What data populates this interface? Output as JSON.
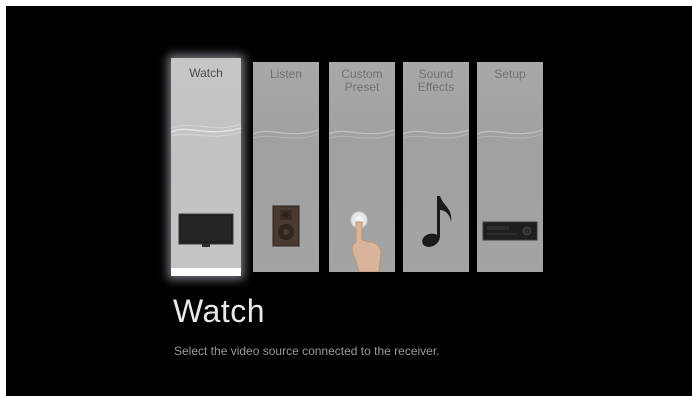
{
  "menu": {
    "items": [
      {
        "label": "Watch",
        "icon": "tv-icon"
      },
      {
        "label": "Listen",
        "icon": "speaker-icon"
      },
      {
        "label": "Custom\nPreset",
        "icon": "finger-touch-icon"
      },
      {
        "label": "Sound\nEffects",
        "icon": "music-note-icon"
      },
      {
        "label": "Setup",
        "icon": "receiver-icon"
      }
    ],
    "selected": "Watch"
  },
  "detail": {
    "title": "Watch",
    "description": "Select the video source connected to the receiver."
  },
  "colors": {
    "background": "#000000",
    "tile": "#a3a5a6",
    "tile_selected": "#c3c5c6",
    "selection_bar": "#ffffff",
    "title_text": "#e8e8e8",
    "description_text": "#9a9a9a"
  }
}
